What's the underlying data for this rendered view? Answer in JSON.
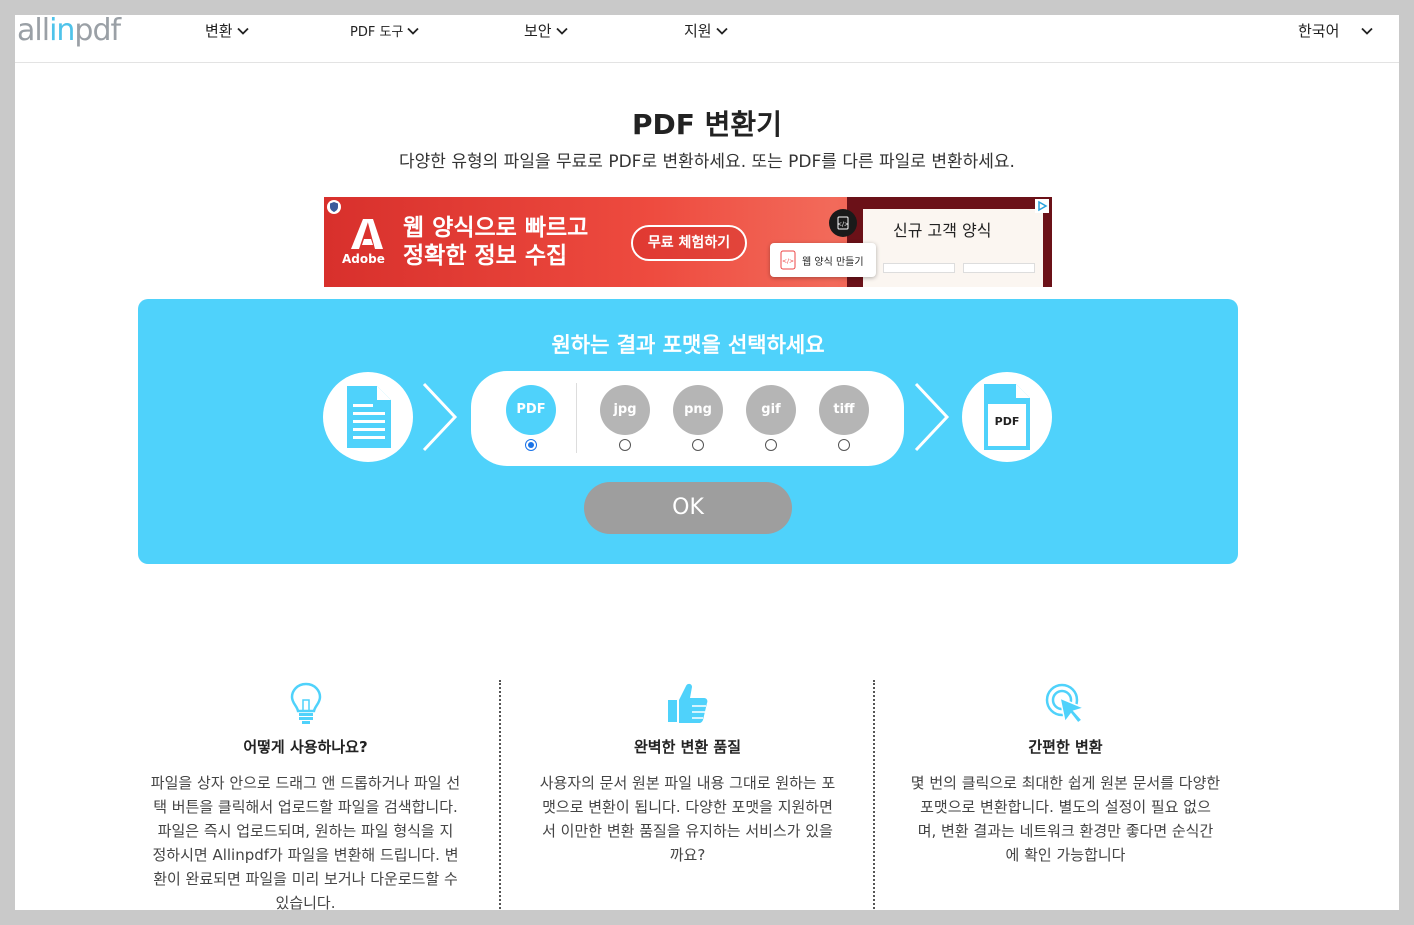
{
  "header": {
    "logo": {
      "part1": "all",
      "part2": "in",
      "part3": "pdf"
    },
    "nav": [
      {
        "label": "변환"
      },
      {
        "label": "PDF 도구"
      },
      {
        "label": "보안"
      },
      {
        "label": "지원"
      }
    ],
    "language": "한국어"
  },
  "main": {
    "title": "PDF 변환기",
    "subtitle": "다양한 유형의 파일을 무료로 PDF로 변환하세요. 또는 PDF를 다른 파일로 변환하세요."
  },
  "ad": {
    "brand": "Adobe",
    "headline_line1": "웹 양식으로 빠르고",
    "headline_line2": "정확한 정보 수집",
    "cta": "무료 체험하기",
    "form_title": "신규 고객 양식",
    "badge": "웹 양식 만들기"
  },
  "converter": {
    "title": "원하는 결과 포맷을 선택하세요",
    "formats": [
      {
        "label": "PDF",
        "selected": true
      },
      {
        "label": "jpg",
        "selected": false
      },
      {
        "label": "png",
        "selected": false
      },
      {
        "label": "gif",
        "selected": false
      },
      {
        "label": "tiff",
        "selected": false
      }
    ],
    "output_icon_label": "PDF",
    "ok_label": "OK"
  },
  "features": [
    {
      "icon": "lightbulb-icon",
      "title": "어떻게 사용하나요?",
      "lines": [
        "파일을 상자 안으로 드래그 앤 드롭하거나 파일 선",
        "택 버튼을 클릭해서 업로드할 파일을 검색합니다.",
        "파일은 즉시 업로드되며, 원하는 파일 형식을 지",
        "정하시면 Allinpdf가 파일을 변환해 드립니다. 변",
        "환이 완료되면 파일을 미리 보거나 다운로드할 수",
        "있습니다."
      ]
    },
    {
      "icon": "thumbs-up-icon",
      "title": "완벽한 변환 품질",
      "lines": [
        "사용자의 문서 원본 파일 내용 그대로 원하는 포",
        "맷으로 변환이 됩니다. 다양한 포맷을 지원하면",
        "서 이만한 변환 품질을 유지하는 서비스가 있을",
        "까요?"
      ]
    },
    {
      "icon": "click-cursor-icon",
      "title": "간편한 변환",
      "lines": [
        "몇 번의 클릭으로 최대한 쉽게 원본 문서를 다양한",
        "포맷으로 변환합니다. 별도의 설정이 필요 없으",
        "며, 변환 결과는 네트워크 환경만 좋다면 순식간",
        "에 확인 가능합니다"
      ]
    }
  ],
  "colors": {
    "accent": "#4fd2fb",
    "ok_button": "#9e9e9e",
    "format_inactive": "#b5b5b5",
    "logo_accent": "#4fc3ea"
  }
}
